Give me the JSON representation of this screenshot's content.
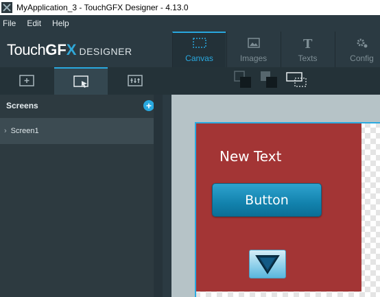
{
  "window": {
    "title": "MyApplication_3 - TouchGFX Designer - 4.13.0"
  },
  "menu": {
    "items": [
      "File",
      "Edit",
      "Help"
    ]
  },
  "logo": {
    "touch": "Touch",
    "gfx": "GF",
    "x": "X",
    "designer": "DESIGNER"
  },
  "tabs": [
    {
      "label": "Canvas",
      "icon": "canvas-icon",
      "active": true
    },
    {
      "label": "Images",
      "icon": "images-icon",
      "active": false
    },
    {
      "label": "Texts",
      "icon": "texts-icon",
      "active": false
    },
    {
      "label": "Config",
      "icon": "config-icon",
      "active": false
    }
  ],
  "subtabs": [
    {
      "icon": "add-screen-icon",
      "active": false
    },
    {
      "icon": "select-screen-icon",
      "active": true
    },
    {
      "icon": "interactions-icon",
      "active": false
    }
  ],
  "arrange_tools": [
    "bring-forward-icon",
    "send-backward-icon",
    "group-icon"
  ],
  "screens_panel": {
    "title": "Screens",
    "add_icon": "plus-icon",
    "items": [
      {
        "label": "Screen1"
      }
    ]
  },
  "canvas": {
    "box_color": "#a33535",
    "text_widget": "New Text",
    "button_label": "Button",
    "toggle_icon": "triangle-down-icon"
  },
  "colors": {
    "accent": "#29a9e0",
    "panel": "#2d3a40",
    "header": "#2b3a42"
  }
}
